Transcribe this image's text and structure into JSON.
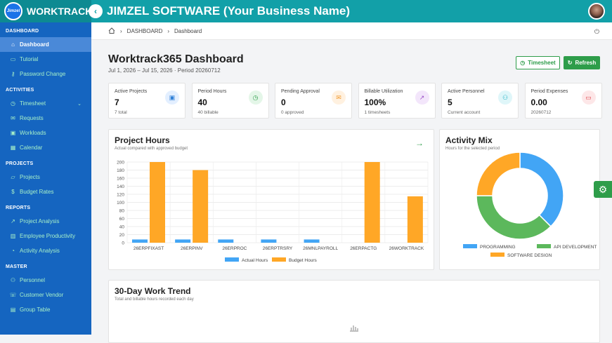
{
  "header": {
    "logo_text": "Jimzel",
    "brand": "WORKTRACK365",
    "company": "JIMZEL SOFTWARE (Your Business Name)"
  },
  "sidebar": {
    "sections": [
      {
        "title": "DASHBOARD",
        "items": [
          {
            "label": "Dashboard",
            "icon": "home-icon",
            "active": true
          },
          {
            "label": "Tutorial",
            "icon": "monitor-icon"
          },
          {
            "label": "Password Change",
            "icon": "key-icon"
          }
        ]
      },
      {
        "title": "ACTIVITIES",
        "items": [
          {
            "label": "Timesheet",
            "icon": "clock-icon",
            "chevron": true
          },
          {
            "label": "Requests",
            "icon": "inbox-icon"
          },
          {
            "label": "Workloads",
            "icon": "briefcase-icon"
          },
          {
            "label": "Calendar",
            "icon": "calendar-icon"
          }
        ]
      },
      {
        "title": "PROJECTS",
        "items": [
          {
            "label": "Projects",
            "icon": "folder-icon"
          },
          {
            "label": "Budget Rates",
            "icon": "dollar-icon"
          }
        ]
      },
      {
        "title": "REPORTS",
        "items": [
          {
            "label": "Project Analysis",
            "icon": "trend-icon"
          },
          {
            "label": "Employee Productivity",
            "icon": "bar-icon"
          },
          {
            "label": "Activity Analysis",
            "icon": "pie-icon"
          }
        ]
      },
      {
        "title": "MASTER",
        "items": [
          {
            "label": "Personnel",
            "icon": "users-icon"
          },
          {
            "label": "Customer Vendor",
            "icon": "contact-icon"
          },
          {
            "label": "Group Table",
            "icon": "table-icon"
          }
        ]
      }
    ]
  },
  "breadcrumb": {
    "root": "DASHBOARD",
    "current": "Dashboard"
  },
  "page": {
    "title": "Worktrack365 Dashboard",
    "subtitle": "Jul 1, 2026 – Jul 15, 2026 · Period 20260712",
    "timesheet_label": "Timesheet",
    "refresh_label": "Refresh"
  },
  "cards": [
    {
      "label": "Active Projects",
      "value": "7",
      "sub": "7 total",
      "icon": "briefcase-icon",
      "color": "#2f80d8",
      "bg": "#e3efff"
    },
    {
      "label": "Period Hours",
      "value": "40",
      "sub": "40 billable",
      "icon": "clock-icon",
      "color": "#2e9d4a",
      "bg": "#e4f6e8"
    },
    {
      "label": "Pending Approval",
      "value": "0",
      "sub": "0 approved",
      "icon": "inbox-icon",
      "color": "#f29a2e",
      "bg": "#fff1e0"
    },
    {
      "label": "Billable Utilization",
      "value": "100%",
      "sub": "1 timesheets",
      "icon": "chart-icon",
      "color": "#9b4fc8",
      "bg": "#f3e6fb"
    },
    {
      "label": "Active Personnel",
      "value": "5",
      "sub": "Current account",
      "icon": "users-icon",
      "color": "#1fb2c4",
      "bg": "#dff6f9"
    },
    {
      "label": "Period Expenses",
      "value": "0.00",
      "sub": "20260712",
      "icon": "wallet-icon",
      "color": "#e0474c",
      "bg": "#fde7e8"
    }
  ],
  "project_hours": {
    "title": "Project Hours",
    "subtitle": "Actual compared with approved budget"
  },
  "activity_mix": {
    "title": "Activity Mix",
    "subtitle": "Hours for the selected period"
  },
  "trend": {
    "title": "30-Day Work Trend",
    "subtitle": "Total and billable hours recorded each day"
  },
  "chart_data": [
    {
      "type": "bar",
      "categories": [
        "26ERPFIXAST",
        "26ERPINV",
        "26ERPROC",
        "26ERPTRSRY",
        "26MNLPAYROLL",
        "26ERPACTG",
        "26WORKTRACK"
      ],
      "series": [
        {
          "name": "Actual Hours",
          "color": "#42a5f5",
          "values": [
            8,
            8,
            8,
            8,
            8,
            0,
            0
          ]
        },
        {
          "name": "Budget Hours",
          "color": "#ffa726",
          "values": [
            200,
            180,
            0,
            0,
            0,
            200,
            115
          ]
        }
      ],
      "ylim": [
        0,
        200
      ],
      "yticks": [
        0,
        20,
        40,
        60,
        80,
        100,
        120,
        140,
        160,
        180,
        200
      ],
      "grid": true,
      "legend": "bottom"
    },
    {
      "type": "pie",
      "donut": true,
      "labels": [
        "PROGRAMMING",
        "API DEVELOPMENT",
        "SOFTWARE DESIGN"
      ],
      "values": [
        37.5,
        37.5,
        25
      ],
      "colors": [
        "#42a5f5",
        "#5cb85c",
        "#ffa726"
      ],
      "legend": "bottom"
    }
  ]
}
